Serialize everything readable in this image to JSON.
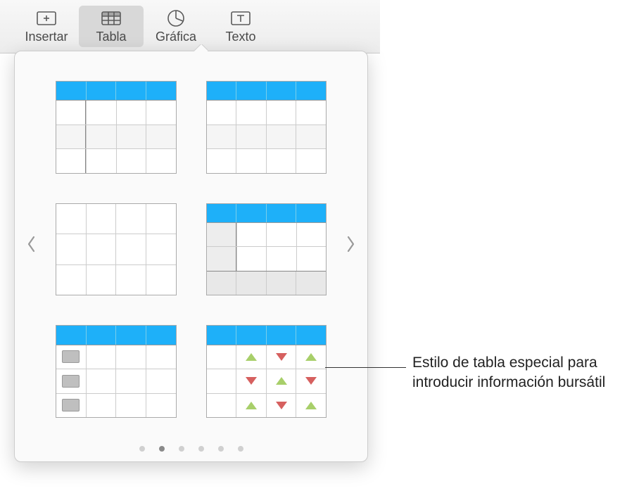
{
  "toolbar": {
    "insert_label": "Insertar",
    "table_label": "Tabla",
    "chart_label": "Gráfica",
    "text_label": "Texto",
    "active": "table"
  },
  "popover": {
    "nav_prev": "‹",
    "nav_next": "›",
    "page_count": 6,
    "page_active_index": 1,
    "styles": [
      {
        "id": "header-altrows-firstcol",
        "header": true,
        "alt_rows": true,
        "first_col_separator": true
      },
      {
        "id": "header-altrows",
        "header": true,
        "alt_rows": true
      },
      {
        "id": "plain-grid",
        "header": false,
        "alt_rows": false
      },
      {
        "id": "header-firstcol-footer",
        "header": true,
        "first_col_shade": true,
        "footer": true
      },
      {
        "id": "header-pill-rows",
        "header": true,
        "pill_first_col": true
      },
      {
        "id": "stock-arrows",
        "header": true,
        "stock": true
      }
    ]
  },
  "callout": {
    "text": "Estilo de tabla especial para introducir información bursátil"
  }
}
